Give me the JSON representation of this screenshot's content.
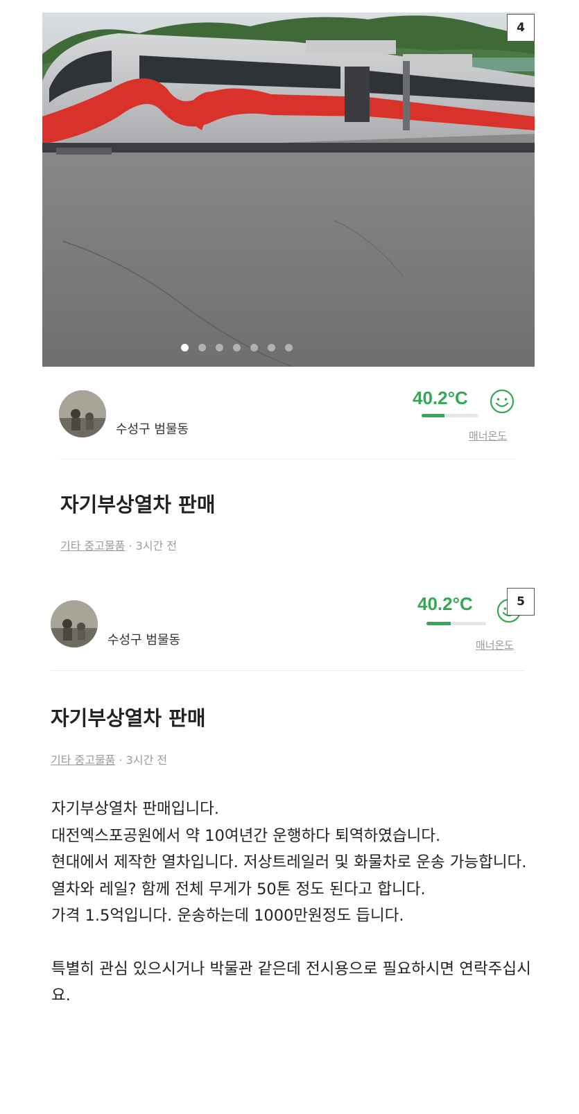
{
  "image_badge_1": "4",
  "image_badge_2": "5",
  "carousel": {
    "dot_count": 7,
    "active_index": 0
  },
  "seller": {
    "location": "수성구 범물동",
    "temperature": "40.2°C",
    "temperature_level": 0.402,
    "manner_label": "매너온도"
  },
  "post": {
    "title": "자기부상열차 판매",
    "category": "기타 중고물품",
    "time": "· 3시간 전"
  },
  "description": [
    "자기부상열차 판매입니다.",
    "대전엑스포공원에서 약 10여년간 운행하다 퇴역하였습니다.",
    "현대에서 제작한 열차입니다. 저상트레일러 및 화물차로 운송 가능합니다.",
    "열차와 레일? 함께 전체 무게가 50톤 정도 된다고 합니다.",
    "가격 1.5억입니다. 운송하는데 1000만원정도 듭니다.",
    "",
    "특별히 관심 있으시거나 박물관 같은데 전시용으로 필요하시면 연락주십시요."
  ],
  "colors": {
    "accent": "#32a852",
    "muted_text": "#9a9a9a",
    "train_red": "#d8322a"
  }
}
